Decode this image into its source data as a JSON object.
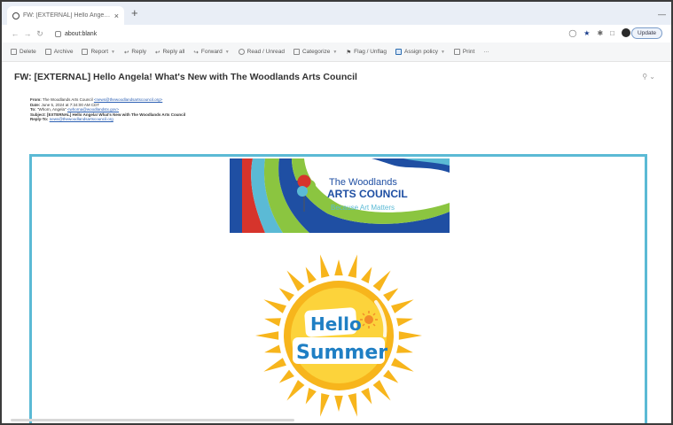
{
  "browser": {
    "tab_title": "FW: [EXTERNAL] Hello Angela! What's...",
    "tab_close": "×",
    "new_tab": "+",
    "window_controls": "—",
    "url": "about:blank",
    "update_label": "Update"
  },
  "toolbar": {
    "delete": "Delete",
    "archive": "Archive",
    "report": "Report",
    "reply": "Reply",
    "reply_all": "Reply all",
    "forward": "Forward",
    "read_unread": "Read / Unread",
    "categorize": "Categorize",
    "flag": "Flag / Unflag",
    "assign_policy": "Assign policy",
    "print": "Print",
    "more": "···"
  },
  "email": {
    "subject": "FW: [EXTERNAL] Hello Angela! What's New with The Woodlands Arts Council",
    "headers": {
      "from_label": "From:",
      "from_value": "The Woodlands Arts Council",
      "from_email": "<news@thewoodlandsartscouncil.org>",
      "date_label": "Date:",
      "date_value": "June 5, 2024 at 7:34:00 AM CDT",
      "to_label": "To:",
      "to_value": "\"Whorn, Angela\"",
      "to_email": "<whorna@woodlandstx.gov>",
      "subject_label": "Subject:",
      "subject_value": "[EXTERNAL] Hello Angela! What's New with The Woodlands Arts Council",
      "replyto_label": "Reply-To:",
      "replyto_value": "news@thewoodlandsartscouncil.org"
    }
  },
  "newsletter": {
    "org_line1": "The Woodlands",
    "org_line2": "ARTS COUNCIL",
    "tagline": "Because Art Matters",
    "hello": "Hello",
    "summer": "Summer"
  },
  "colors": {
    "card_border": "#5bbad5",
    "sun_yellow": "#f7b51c",
    "sun_inner": "#fcd33b",
    "brand_blue": "#1f4fa3"
  }
}
